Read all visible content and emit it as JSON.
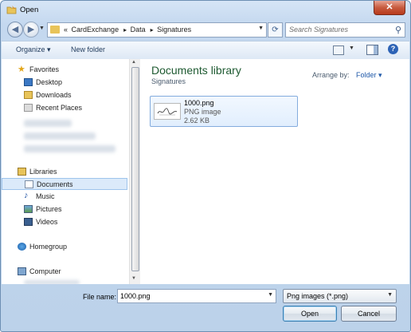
{
  "window": {
    "title": "Open",
    "close_glyph": "✕"
  },
  "address": {
    "overflow": "«",
    "crumbs": [
      "CardExchange",
      "Data",
      "Signatures"
    ],
    "search_placeholder": "Search Signatures"
  },
  "toolbar": {
    "organize_label": "Organize ▾",
    "new_folder_label": "New folder"
  },
  "nav": {
    "favorites_label": "Favorites",
    "favorites": [
      "Desktop",
      "Downloads",
      "Recent Places"
    ],
    "libraries_label": "Libraries",
    "libraries": [
      "Documents",
      "Music",
      "Pictures",
      "Videos"
    ],
    "homegroup_label": "Homegroup",
    "computer_label": "Computer"
  },
  "content": {
    "library_title": "Documents library",
    "library_subtitle": "Signatures",
    "arrange_label": "Arrange by:",
    "arrange_value": "Folder ▾",
    "files": [
      {
        "name": "1000.png",
        "type": "PNG image",
        "size": "2.62 KB"
      }
    ]
  },
  "footer": {
    "file_name_label": "File name:",
    "file_name_value": "1000.png",
    "file_type_value": "Png images (*.png)",
    "open_label": "Open",
    "cancel_label": "Cancel"
  },
  "colors": {
    "library_title": "#1e5a31",
    "selection": "#dbeafa",
    "close_button": "#c75b3f"
  }
}
